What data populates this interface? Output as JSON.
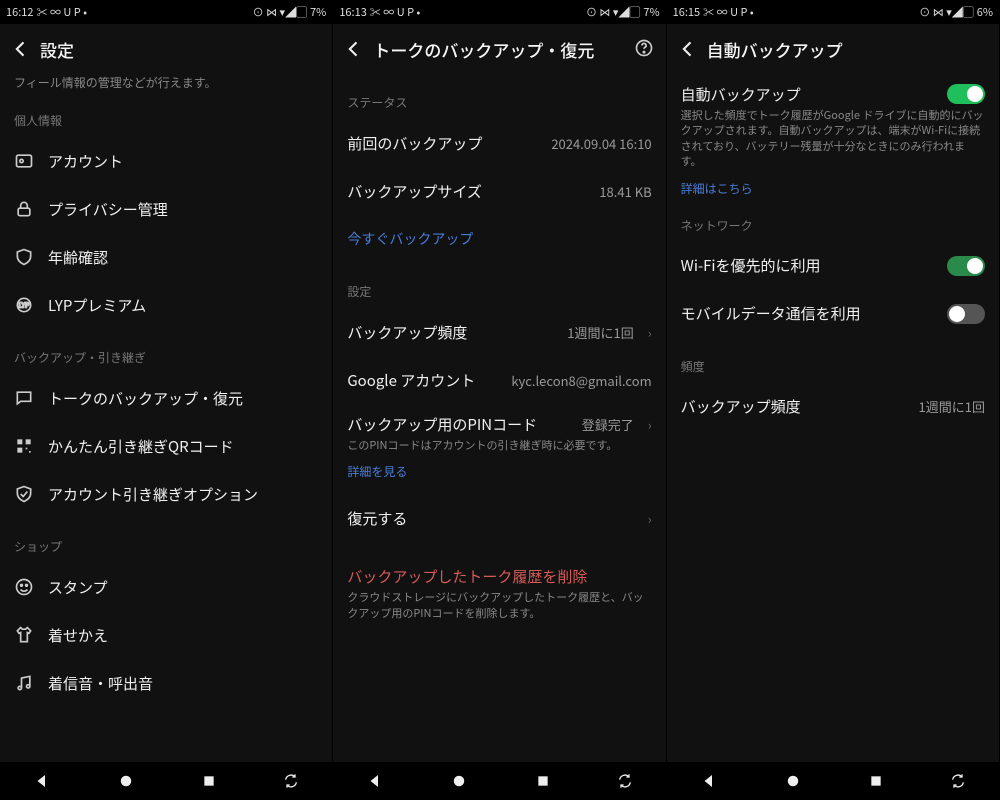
{
  "screens": [
    {
      "status": {
        "time": "16:12",
        "leftIcons": "✂ ∞ U P •",
        "rightIcons": "⊙ ⋈ ▾◢▢",
        "battery": "7%"
      },
      "title": "設定",
      "descTop": "フィール情報の管理などが行えます。",
      "sections": [
        {
          "header": "個人情報",
          "items": [
            {
              "icon": "user",
              "label": "アカウント"
            },
            {
              "icon": "lock",
              "label": "プライバシー管理"
            },
            {
              "icon": "shield",
              "label": "年齢確認"
            },
            {
              "icon": "star",
              "label": "LYPプレミアム"
            }
          ]
        },
        {
          "header": "バックアップ・引き継ぎ",
          "items": [
            {
              "icon": "chat",
              "label": "トークのバックアップ・復元"
            },
            {
              "icon": "qr",
              "label": "かんたん引き継ぎQRコード"
            },
            {
              "icon": "check",
              "label": "アカウント引き継ぎオプション"
            }
          ]
        },
        {
          "header": "ショップ",
          "items": [
            {
              "icon": "smile",
              "label": "スタンプ"
            },
            {
              "icon": "shirt",
              "label": "着せかえ"
            },
            {
              "icon": "music",
              "label": "着信音・呼出音"
            }
          ]
        }
      ]
    },
    {
      "status": {
        "time": "16:13",
        "leftIcons": "✂ ∞ U P •",
        "rightIcons": "⊙ ⋈ ▾◢▢",
        "battery": "7%"
      },
      "title": "トークのバックアップ・復元",
      "help": true,
      "statusSection": {
        "header": "ステータス",
        "lastBackupLabel": "前回のバックアップ",
        "lastBackupValue": "2024.09.04 16:10",
        "sizeLabel": "バックアップサイズ",
        "sizeValue": "18.41 KB",
        "nowLabel": "今すぐバックアップ"
      },
      "settingsSection": {
        "header": "設定",
        "freqLabel": "バックアップ頻度",
        "freqValue": "1週間に1回",
        "googleLabel": "Google アカウント",
        "googleValue": "kyc.lecon8@gmail.com",
        "pinLabel": "バックアップ用のPINコード",
        "pinValue": "登録完了",
        "pinDesc": "このPINコードはアカウントの引き継ぎ時に必要です。",
        "detailsLink": "詳細を見る",
        "restoreLabel": "復元する",
        "deleteLabel": "バックアップしたトーク履歴を削除",
        "deleteDesc": "クラウドストレージにバックアップしたトーク履歴と、バックアップ用のPINコードを削除します。"
      }
    },
    {
      "status": {
        "time": "16:15",
        "leftIcons": "✂ ∞ U P •",
        "rightIcons": "⊙ ⋈ ▾◢▢",
        "battery": "6%"
      },
      "title": "自動バックアップ",
      "autoSection": {
        "label": "自動バックアップ",
        "toggle": "on",
        "desc": "選択した頻度でトーク履歴がGoogle ドライブに自動的にバックアップされます。自動バックアップは、端末がWi-Fiに接続されており、バッテリー残量が十分なときにのみ行われます。",
        "link": "詳細はこちら"
      },
      "networkSection": {
        "header": "ネットワーク",
        "wifiLabel": "Wi-Fiを優先的に利用",
        "wifiToggle": "on",
        "mobileLabel": "モバイルデータ通信を利用",
        "mobileToggle": "off"
      },
      "freqSection": {
        "header": "頻度",
        "label": "バックアップ頻度",
        "value": "1週間に1回"
      }
    }
  ]
}
